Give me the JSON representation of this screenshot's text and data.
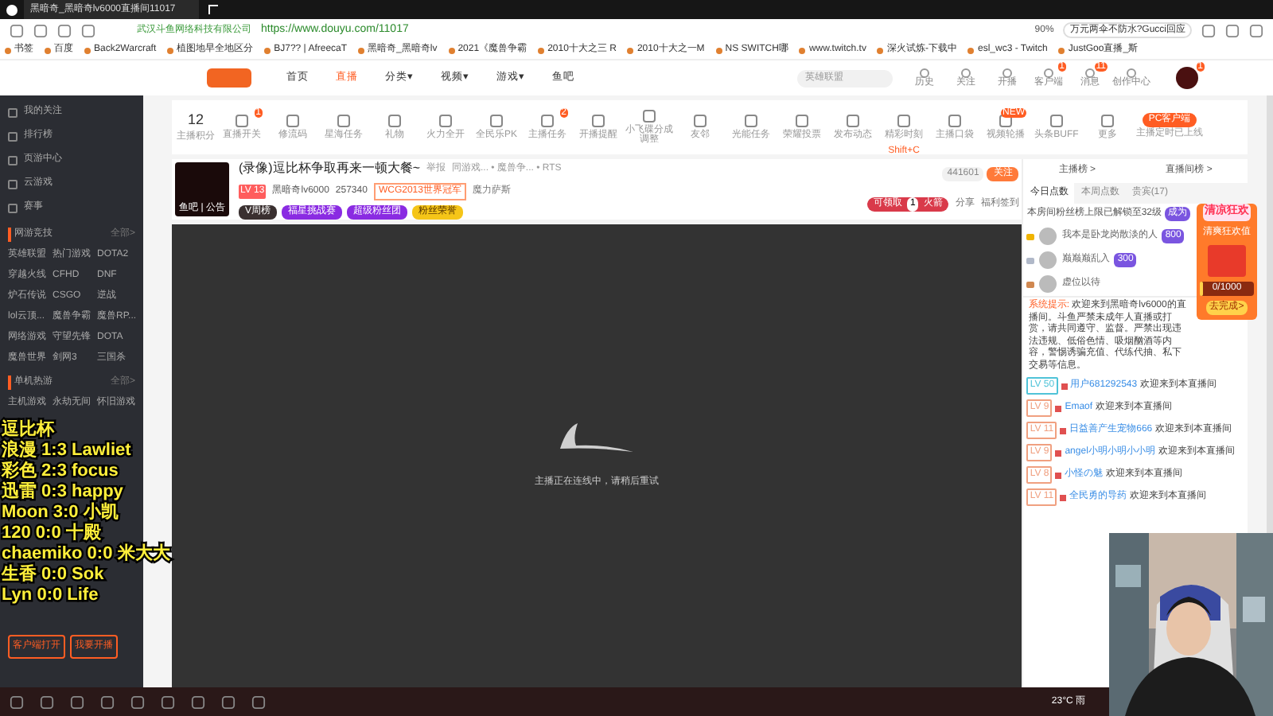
{
  "browser": {
    "tab_title": "黑暗奇_黑暗奇lv6000直播间11017",
    "site_owner": "武汉斗鱼网络科技有限公司",
    "url": "https://www.douyu.com/11017",
    "zoom": "90%",
    "search": "万元两伞不防水?Gucci回应",
    "bookmarks": [
      "书签",
      "百度",
      "Back2Warcraft",
      "植图地早全地区分",
      "BJ7?? | AfreecaT",
      "黑暗奇_黑暗奇lv",
      "2021《魔兽争霸",
      "2010十大之三 R",
      "2010十大之一M",
      "NS SWITCH哪",
      "www.twitch.tv",
      "深火试炼-下载中",
      "esl_wc3 - Twitch",
      "JustGoo直播_斯"
    ]
  },
  "header": {
    "nav": [
      {
        "label": "首页",
        "selected": false
      },
      {
        "label": "直播",
        "selected": true
      },
      {
        "label": "分类▾",
        "selected": false
      },
      {
        "label": "视频▾",
        "selected": false
      },
      {
        "label": "游戏▾",
        "selected": false
      },
      {
        "label": "鱼吧",
        "selected": false
      }
    ],
    "search_placeholder": "英雄联盟",
    "actions": [
      {
        "label": "历史"
      },
      {
        "label": "关注"
      },
      {
        "label": "开播"
      },
      {
        "label": "客户端",
        "badge": "1"
      },
      {
        "label": "消息",
        "badge": "11"
      },
      {
        "label": "创作中心"
      }
    ],
    "avatar_badge": "1"
  },
  "sidebar": {
    "items": [
      "我的关注",
      "排行榜",
      "页游中心",
      "云游戏",
      "赛事"
    ],
    "section": {
      "title": "网游竞技",
      "more": "全部>",
      "games": [
        "英雄联盟",
        "热门游戏",
        "DOTA2",
        "穿越火线",
        "CFHD",
        "DNF",
        "炉石传说",
        "CSGO",
        "逆战",
        "lol云顶...",
        "魔兽争霸",
        "魔兽RP...",
        "网络游戏",
        "守望先锋",
        "DOTA",
        "魔兽世界",
        "剑网3",
        "三国杀"
      ]
    },
    "section2": {
      "title": "单机热游",
      "more": "全部>",
      "games": [
        "主机游戏",
        "永劫无间",
        "怀旧游戏"
      ]
    },
    "buttons": [
      "客户端打开",
      "我要开播"
    ]
  },
  "scoreboard": [
    "逗比杯",
    "浪漫 1:3 Lawliet",
    "彩色 2:3 focus",
    "迅雷 0:3 happy",
    "Moon 3:0 小凯",
    "120 0:0 十殿",
    "chaemiko 0:0 米大大",
    "生香 0:0 Sok",
    "Lyn 0:0 Life"
  ],
  "toolbar": {
    "points": "12",
    "points_label": "主播积分",
    "tools": [
      {
        "label": "直播开关",
        "badge": "1"
      },
      {
        "label": "修流码"
      },
      {
        "label": "星海任务"
      },
      {
        "label": "礼物"
      },
      {
        "label": "火力全开"
      },
      {
        "label": "全民乐PK"
      },
      {
        "label": "主播任务",
        "badge": "2"
      },
      {
        "label": "开播提醒"
      },
      {
        "label": "小飞碟分成调整"
      },
      {
        "label": "友邻"
      },
      {
        "label": "光能任务"
      },
      {
        "label": "荣耀投票"
      },
      {
        "label": "发布动态"
      },
      {
        "label": "精彩时刻",
        "hint": "Shift+C"
      },
      {
        "label": "主播口袋"
      },
      {
        "label": "视频轮播",
        "badge": "NEW"
      },
      {
        "label": "头条BUFF"
      },
      {
        "label": "更多"
      }
    ],
    "pc_button": "PC客户端",
    "pc_note": "主播定时已上线"
  },
  "room": {
    "title": "(录像)逗比杯争取再来一顿大餐~",
    "report": "举报",
    "crumbs": "同游戏... • 魔兽争... • RTS",
    "level": "LV 13",
    "streamer": "黑暗奇lv6000",
    "heat": "257340",
    "honor": "WCG2013世界冠军",
    "location": "魔力萨斯",
    "avatar_caption": "鱼吧 | 公告",
    "badges": [
      "V周榜",
      "福星挑战赛",
      "超级粉丝团",
      "粉丝荣誉"
    ],
    "followers": "441601",
    "follow": "关注",
    "rocket_left": "可领取",
    "rocket_count": "1",
    "rocket_right": "火箭",
    "share": "分享",
    "checkin": "福利签到"
  },
  "player": {
    "status": "主播正在连线中，请稍后重试"
  },
  "chat": {
    "rank_tabs": [
      "主播榜 >",
      "直播间榜 >"
    ],
    "tabs": [
      {
        "label": "今日点数",
        "selected": true
      },
      {
        "label": "本周点数",
        "selected": false
      },
      {
        "label": "贵宾(17)",
        "selected": false
      }
    ],
    "note": "本房间粉丝榜上限已解锁至32级",
    "join": "成为",
    "ranks": [
      {
        "name": "我本是卧龙岗散淡的人",
        "score": "800",
        "color": "#f0b400"
      },
      {
        "name": "巅巅巅乱入",
        "score": "300",
        "color": "#b0b8c8"
      },
      {
        "name": "虚位以待",
        "color": "#d08850"
      }
    ],
    "system_label": "系统提示:",
    "system_text": "欢迎来到黑暗奇lv6000的直播间。斗鱼严禁未成年人直播或打赏，请共同遵守、监督。严禁出现违法违规、低俗色情、吸烟酗酒等内容，警惕诱骗充值、代练代抽、私下交易等信息。",
    "messages": [
      {
        "level": "LV 50",
        "user": "用户681292543",
        "text": "欢迎来到本直播间",
        "color": "#4fc3d8"
      },
      {
        "level": "LV 9",
        "user": "Emaof",
        "text": "欢迎来到本直播间",
        "color": "#f0a080"
      },
      {
        "level": "LV 11",
        "user": "日益善产生宠物666",
        "text": "欢迎来到本直播间",
        "color": "#f0a080"
      },
      {
        "level": "LV 9",
        "user": "angel小明小明小小明",
        "text": "欢迎来到本直播间",
        "color": "#f0a080"
      },
      {
        "level": "LV 8",
        "user": "小怪の魅",
        "text": "欢迎来到本直播间",
        "color": "#f0a080"
      },
      {
        "level": "LV 11",
        "user": "全民勇的导药",
        "text": "欢迎来到本直播间",
        "color": "#f0a080"
      }
    ]
  },
  "promo": {
    "title": "清凉狂欢",
    "subtitle": "清爽狂欢值",
    "progress": "0/1000",
    "level": 0,
    "button": "去完成>"
  },
  "taskbar": {
    "weather": "23°C 雨"
  }
}
